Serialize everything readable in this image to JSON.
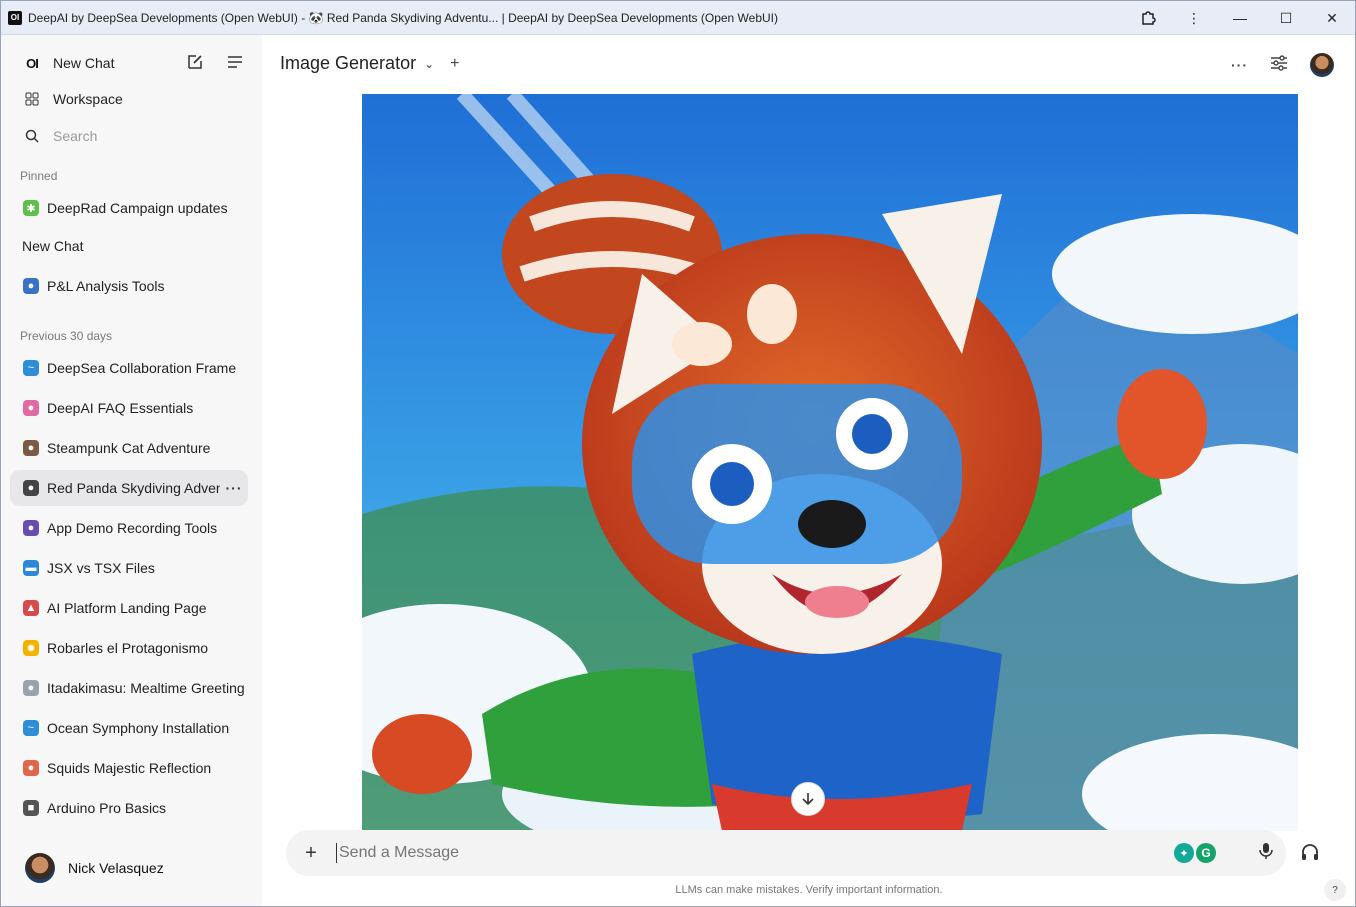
{
  "titlebar": {
    "logo": "OI",
    "title": "DeepAI by  DeepSea Developments (Open WebUI) - 🐼 Red Panda Skydiving Adventu... | DeepAI by DeepSea Developments (Open WebUI)"
  },
  "sidebar": {
    "new_chat": "New Chat",
    "workspace": "Workspace",
    "search_placeholder": "Search",
    "pinned_label": "Pinned",
    "pinned": [
      {
        "label": "DeepRad Campaign updates",
        "icon": "puzzle-icon",
        "color": "#5fbf4a"
      },
      {
        "label": "New Chat",
        "icon": "",
        "color": ""
      },
      {
        "label": "P&L Analysis Tools",
        "icon": "magnifier-icon",
        "color": "#3a73c4"
      }
    ],
    "previous_label": "Previous 30 days",
    "chats": [
      {
        "label": "DeepSea Collaboration Frame",
        "icon": "wave-icon",
        "color": "#2f8fd6"
      },
      {
        "label": "DeepAI FAQ Essentials",
        "icon": "brain-icon",
        "color": "#e06aa3"
      },
      {
        "label": "Steampunk Cat Adventure",
        "icon": "cat-icon",
        "color": "#7a5a44"
      },
      {
        "label": "Red Panda Skydiving Adventure",
        "icon": "panda-icon",
        "color": "#444444"
      },
      {
        "label": "App Demo Recording Tools",
        "icon": "camera-icon",
        "color": "#6a4bb0"
      },
      {
        "label": "JSX vs TSX Files",
        "icon": "computer-icon",
        "color": "#2b88d8"
      },
      {
        "label": "AI Platform Landing Page",
        "icon": "rocket-icon",
        "color": "#d64b4b"
      },
      {
        "label": "Robarles el Protagonismo",
        "icon": "sun-icon",
        "color": "#f0b400"
      },
      {
        "label": "Itadakimasu: Mealtime Greeting",
        "icon": "plate-icon",
        "color": "#9aa3ad"
      },
      {
        "label": "Ocean Symphony Installation",
        "icon": "wave-icon",
        "color": "#2f8fd6"
      },
      {
        "label": "Squids Majestic Reflection",
        "icon": "squid-icon",
        "color": "#e0664a"
      },
      {
        "label": "Arduino Pro Basics",
        "icon": "robot-icon",
        "color": "#555555"
      }
    ],
    "user_name": "Nick Velasquez"
  },
  "main": {
    "model_name": "Image Generator",
    "composer_placeholder": "Send a Message",
    "grammarly_badge": "G",
    "disclaimer": "LLMs can make mistakes. Verify important information.",
    "help": "?"
  }
}
